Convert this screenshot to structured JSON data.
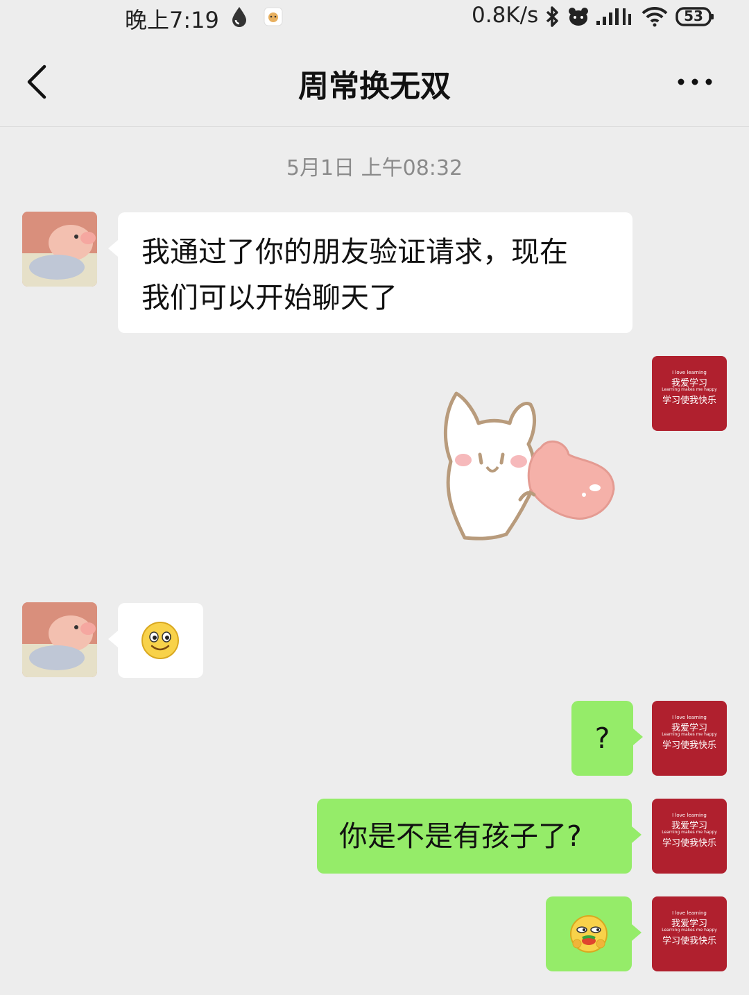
{
  "status_bar": {
    "time": "晚上7:19",
    "net_speed": "0.8K/s",
    "battery": "53"
  },
  "header": {
    "title": "周常换无双"
  },
  "chat": {
    "timestamp": "5月1日 上午08:32",
    "messages": [
      {
        "side": "in",
        "text": "我通过了你的朋友验证请求，现在",
        "text2": "我们可以开始聊天了"
      },
      {
        "side": "out",
        "type": "sticker",
        "sticker": "bunny-heart-sticker"
      },
      {
        "side": "in",
        "type": "emoji",
        "emoji": "smile-emoji"
      },
      {
        "side": "out",
        "text": "?"
      },
      {
        "side": "out",
        "text": "你是不是有孩子了?"
      },
      {
        "side": "out",
        "type": "emoji",
        "emoji": "eating-emoji"
      }
    ]
  },
  "my_avatar": {
    "line1": "I love learning",
    "line2": "我爱学习",
    "line3": "Learning makes me happy",
    "line4": "学习使我快乐",
    "color": "#b0202e"
  },
  "colors": {
    "background": "#ededed",
    "bubble_in": "#ffffff",
    "bubble_out": "#95ec69"
  }
}
